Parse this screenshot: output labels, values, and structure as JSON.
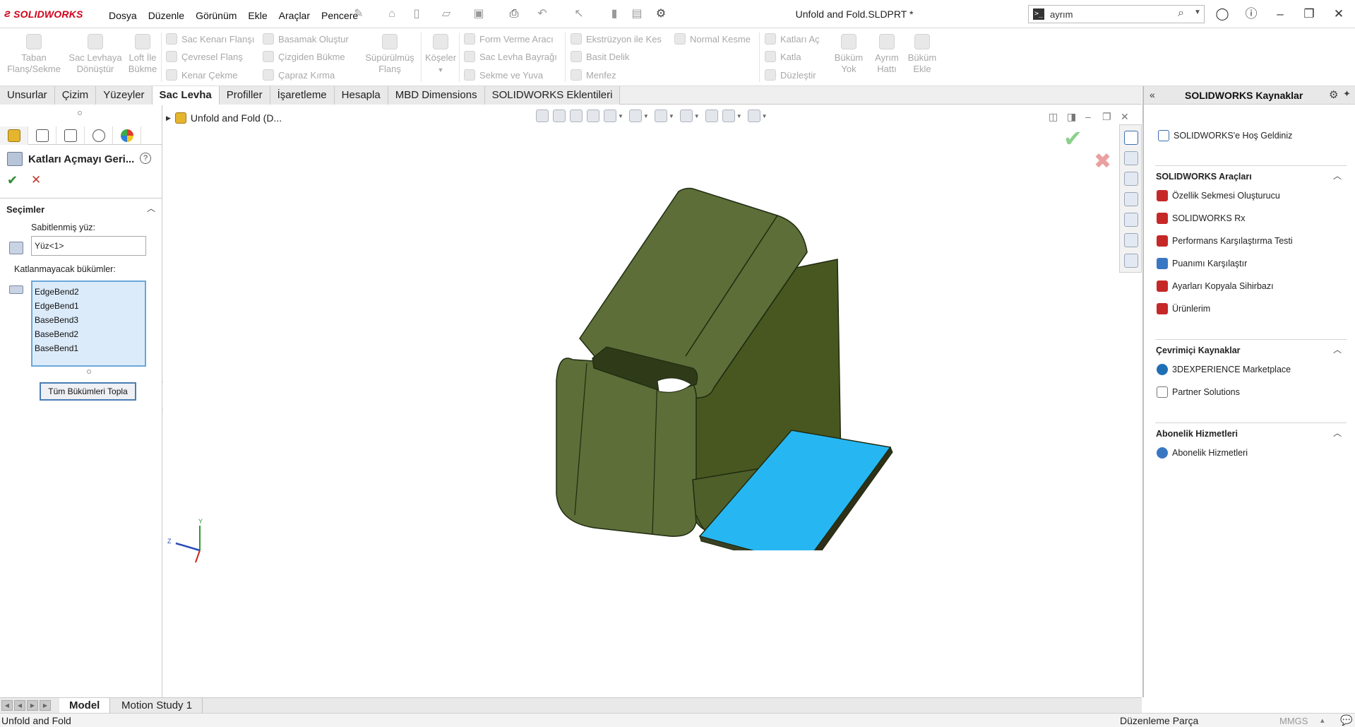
{
  "app": {
    "logo_text": "SOLIDWORKS",
    "document_title": "Unfold and Fold.SLDPRT *"
  },
  "menu": [
    "Dosya",
    "Düzenle",
    "Görünüm",
    "Ekle",
    "Araçlar",
    "Pencere"
  ],
  "search": {
    "value": "ayrım"
  },
  "ribbon": {
    "big_buttons": [
      {
        "label1": "Taban",
        "label2": "Flanş/Sekme"
      },
      {
        "label1": "Sac Levhaya",
        "label2": "Dönüştür"
      },
      {
        "label1": "Loft İle",
        "label2": "Bükme"
      },
      {
        "label1": "Süpürülmüş",
        "label2": "Flanş"
      },
      {
        "label1": "Köşeler",
        "label2": ""
      },
      {
        "label1": "Büküm",
        "label2": "Yok"
      },
      {
        "label1": "Ayrım",
        "label2": "Hattı"
      },
      {
        "label1": "Büküm",
        "label2": "Ekle"
      }
    ],
    "small_buttons": [
      "Sac Kenarı Flanşı",
      "Çevresel Flanş",
      "Kenar Çekme",
      "Basamak Oluştur",
      "Çizgiden Bükme",
      "Çapraz Kırma",
      "Form Verme Aracı",
      "Sac Levha Bayrağı",
      "Sekme ve Yuva",
      "Ekstrüzyon ile Kes",
      "Basit Delik",
      "Menfez",
      "Normal Kesme",
      "Katları Aç",
      "Katla",
      "Düzleştir"
    ]
  },
  "tabs": [
    "Unsurlar",
    "Çizim",
    "Yüzeyler",
    "Sac Levha",
    "Profiller",
    "İşaretleme",
    "Hesapla",
    "MBD Dimensions",
    "SOLIDWORKS Eklentileri"
  ],
  "active_tab": "Sac Levha",
  "property_manager": {
    "title": "Katları Açmayı Geri...",
    "help": "?",
    "section_title": "Seçimler",
    "fixed_face_label": "Sabitlenmiş yüz:",
    "fixed_face_value": "Yüz<1>",
    "bends_label": "Katlanmayacak bükümler:",
    "bends": [
      "EdgeBend2",
      "EdgeBend1",
      "BaseBend3",
      "BaseBend2",
      "BaseBend1"
    ],
    "collect_button": "Tüm Bükümleri Topla"
  },
  "viewport": {
    "tree_path": "Unfold and Fold  (D...",
    "triad": {
      "x": "Z",
      "y": "Y"
    }
  },
  "task_pane": {
    "title": "SOLIDWORKS Kaynaklar",
    "welcome": "SOLIDWORKS'e Hoş Geldiniz",
    "sections": [
      {
        "title": "SOLIDWORKS Araçları",
        "items": [
          "Özellik Sekmesi Oluşturucu",
          "SOLIDWORKS Rx",
          "Performans Karşılaştırma Testi",
          "Puanımı Karşılaştır",
          "Ayarları Kopyala Sihirbazı",
          "Ürünlerim"
        ]
      },
      {
        "title": "Çevrimiçi Kaynaklar",
        "items": [
          "3DEXPERIENCE Marketplace",
          "Partner Solutions"
        ]
      },
      {
        "title": "Abonelik Hizmetleri",
        "items": [
          "Abonelik Hizmetleri"
        ]
      }
    ]
  },
  "bottom_tabs": [
    "Model",
    "Motion Study 1"
  ],
  "status": {
    "left": "Unfold and Fold",
    "mode": "Düzenleme Parça",
    "units": "MMGS",
    "arrow": "▴"
  },
  "colors": {
    "model_body": "#5d6e38",
    "model_edge": "#1f2a10",
    "fixed_face": "#26b7f2",
    "selection_bg": "#dcebfa"
  }
}
